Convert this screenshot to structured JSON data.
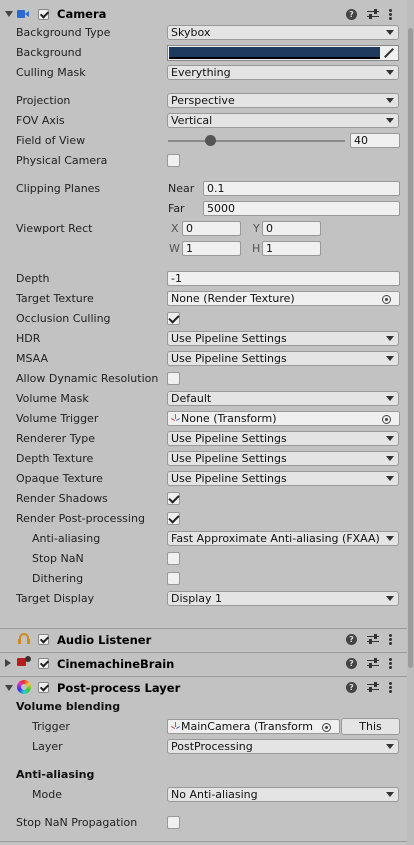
{
  "camera": {
    "title": "Camera",
    "rows": {
      "background_type": {
        "label": "Background Type",
        "value": "Skybox"
      },
      "background": {
        "label": "Background",
        "color": "#1f3a5f"
      },
      "culling_mask": {
        "label": "Culling Mask",
        "value": "Everything"
      },
      "projection": {
        "label": "Projection",
        "value": "Perspective"
      },
      "fov_axis": {
        "label": "FOV Axis",
        "value": "Vertical"
      },
      "field_of_view": {
        "label": "Field of View",
        "value": "40",
        "slider_fraction": 0.24
      },
      "physical_camera": {
        "label": "Physical Camera",
        "checked": false
      },
      "clipping_planes": {
        "label": "Clipping Planes",
        "near_label": "Near",
        "near": "0.1",
        "far_label": "Far",
        "far": "5000"
      },
      "viewport_rect": {
        "label": "Viewport Rect",
        "x_label": "X",
        "x": "0",
        "y_label": "Y",
        "y": "0",
        "w_label": "W",
        "w": "1",
        "h_label": "H",
        "h": "1"
      },
      "depth": {
        "label": "Depth",
        "value": "-1"
      },
      "target_texture": {
        "label": "Target Texture",
        "value": "None (Render Texture)"
      },
      "occlusion_culling": {
        "label": "Occlusion Culling",
        "checked": true
      },
      "hdr": {
        "label": "HDR",
        "value": "Use Pipeline Settings"
      },
      "msaa": {
        "label": "MSAA",
        "value": "Use Pipeline Settings"
      },
      "allow_dynamic_resolution": {
        "label": "Allow Dynamic Resolution",
        "checked": false
      },
      "volume_mask": {
        "label": "Volume Mask",
        "value": "Default"
      },
      "volume_trigger": {
        "label": "Volume Trigger",
        "value": "None (Transform)"
      },
      "renderer_type": {
        "label": "Renderer Type",
        "value": "Use Pipeline Settings"
      },
      "depth_texture": {
        "label": "Depth Texture",
        "value": "Use Pipeline Settings"
      },
      "opaque_texture": {
        "label": "Opaque Texture",
        "value": "Use Pipeline Settings"
      },
      "render_shadows": {
        "label": "Render Shadows",
        "checked": true
      },
      "render_post_processing": {
        "label": "Render Post-processing",
        "checked": true
      },
      "anti_aliasing": {
        "label": "Anti-aliasing",
        "value": "Fast Approximate Anti-aliasing (FXAA)"
      },
      "stop_nan": {
        "label": "Stop NaN",
        "checked": false
      },
      "dithering": {
        "label": "Dithering",
        "checked": false
      },
      "target_display": {
        "label": "Target Display",
        "value": "Display 1"
      }
    }
  },
  "audio_listener": {
    "title": "Audio Listener"
  },
  "cinemachine_brain": {
    "title": "CinemachineBrain"
  },
  "post_process_layer": {
    "title": "Post-process Layer",
    "volume_blending": "Volume blending",
    "trigger": {
      "label": "Trigger",
      "value": "MainCamera (Transform",
      "this_button": "This"
    },
    "layer": {
      "label": "Layer",
      "value": "PostProcessing"
    },
    "anti_aliasing_heading": "Anti-aliasing",
    "mode": {
      "label": "Mode",
      "value": "No Anti-aliasing"
    },
    "stop_nan_propagation": {
      "label": "Stop NaN Propagation",
      "checked": false
    }
  },
  "help_glyph": "?"
}
